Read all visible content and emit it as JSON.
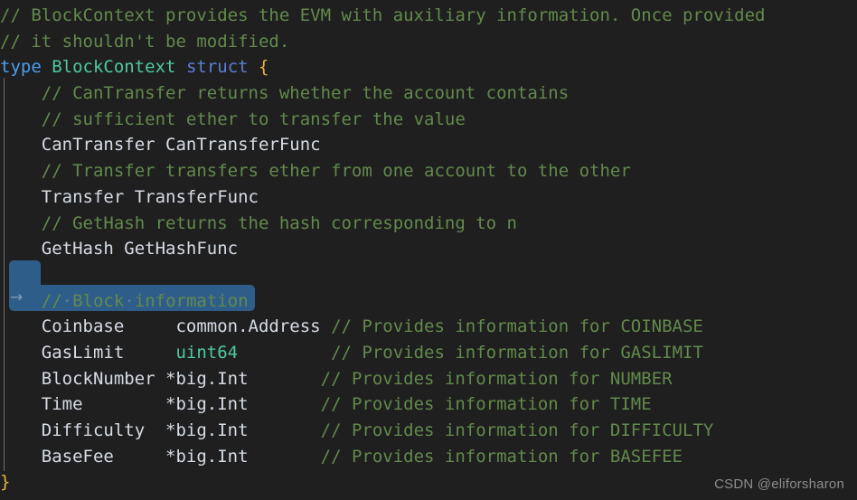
{
  "editor": {
    "background": "#1f1f1f",
    "language": "go",
    "indent_guide_color": "#6e6e6e"
  },
  "theme": {
    "comment": "#628a4c",
    "keyword": "#4a9eed",
    "keyword_struct": "#5b7fd4",
    "type_name": "#4ec9a0",
    "brace": "#e8b33a",
    "identifier": "#d6dce5",
    "selection": "#2f5d8a",
    "whitespace_marker": "#5d7d96",
    "watermark": "#8d8d8d"
  },
  "selection": {
    "tab_arrow_glyph": "→",
    "whitespace_dot": "·",
    "selected_text": "\t// Block information"
  },
  "code": {
    "lines": [
      {
        "id": "line-1",
        "indent": "",
        "tokens": [
          {
            "t": "cmt",
            "v": "// BlockContext provides the EVM with auxiliary information. Once provided"
          }
        ]
      },
      {
        "id": "line-2",
        "indent": "",
        "tokens": [
          {
            "t": "cmt",
            "v": "// it shouldn't be modified."
          }
        ]
      },
      {
        "id": "line-3",
        "indent": "",
        "tokens": [
          {
            "t": "kw",
            "v": "type"
          },
          {
            "t": "id",
            "v": " "
          },
          {
            "t": "typename",
            "v": "BlockContext"
          },
          {
            "t": "id",
            "v": " "
          },
          {
            "t": "kw2",
            "v": "struct"
          },
          {
            "t": "id",
            "v": " "
          },
          {
            "t": "brace",
            "v": "{"
          }
        ]
      },
      {
        "id": "line-4",
        "indent": "    ",
        "tokens": [
          {
            "t": "cmt",
            "v": "// CanTransfer returns whether the account contains"
          }
        ]
      },
      {
        "id": "line-5",
        "indent": "    ",
        "tokens": [
          {
            "t": "cmt",
            "v": "// sufficient ether to transfer the value"
          }
        ]
      },
      {
        "id": "line-6",
        "indent": "    ",
        "tokens": [
          {
            "t": "id",
            "v": "CanTransfer CanTransferFunc"
          }
        ]
      },
      {
        "id": "line-7",
        "indent": "    ",
        "tokens": [
          {
            "t": "cmt",
            "v": "// Transfer transfers ether from one account to the other"
          }
        ]
      },
      {
        "id": "line-8",
        "indent": "    ",
        "tokens": [
          {
            "t": "id",
            "v": "Transfer TransferFunc"
          }
        ]
      },
      {
        "id": "line-9",
        "indent": "    ",
        "tokens": [
          {
            "t": "cmt",
            "v": "// GetHash returns the hash corresponding to n"
          }
        ]
      },
      {
        "id": "line-10",
        "indent": "    ",
        "tokens": [
          {
            "t": "id",
            "v": "GetHash GetHashFunc"
          }
        ]
      },
      {
        "id": "line-11",
        "indent": "",
        "tokens": []
      },
      {
        "id": "line-12",
        "indent": "    ",
        "tokens": [
          {
            "t": "cmt",
            "v": "//"
          },
          {
            "t": "ws",
            "v": "·"
          },
          {
            "t": "cmt",
            "v": "Block"
          },
          {
            "t": "ws",
            "v": "·"
          },
          {
            "t": "cmt",
            "v": "information"
          }
        ]
      },
      {
        "id": "line-13",
        "indent": "    ",
        "tokens": [
          {
            "t": "id",
            "v": "Coinbase     common.Address "
          },
          {
            "t": "cmt",
            "v": "// Provides information for COINBASE"
          }
        ]
      },
      {
        "id": "line-14",
        "indent": "    ",
        "tokens": [
          {
            "t": "id",
            "v": "GasLimit     "
          },
          {
            "t": "typename",
            "v": "uint64"
          },
          {
            "t": "id",
            "v": "         "
          },
          {
            "t": "cmt",
            "v": "// Provides information for GASLIMIT"
          }
        ]
      },
      {
        "id": "line-15",
        "indent": "    ",
        "tokens": [
          {
            "t": "id",
            "v": "BlockNumber *big.Int       "
          },
          {
            "t": "cmt",
            "v": "// Provides information for NUMBER"
          }
        ]
      },
      {
        "id": "line-16",
        "indent": "    ",
        "tokens": [
          {
            "t": "id",
            "v": "Time        *big.Int       "
          },
          {
            "t": "cmt",
            "v": "// Provides information for TIME"
          }
        ]
      },
      {
        "id": "line-17",
        "indent": "    ",
        "tokens": [
          {
            "t": "id",
            "v": "Difficulty  *big.Int       "
          },
          {
            "t": "cmt",
            "v": "// Provides information for DIFFICULTY"
          }
        ]
      },
      {
        "id": "line-18",
        "indent": "    ",
        "tokens": [
          {
            "t": "id",
            "v": "BaseFee     *big.Int       "
          },
          {
            "t": "cmt",
            "v": "// Provides information for BASEFEE"
          }
        ]
      },
      {
        "id": "line-19",
        "indent": "",
        "tokens": [
          {
            "t": "brace",
            "v": "}"
          }
        ]
      }
    ]
  },
  "watermark": {
    "text": "CSDN @eliforsharon"
  }
}
